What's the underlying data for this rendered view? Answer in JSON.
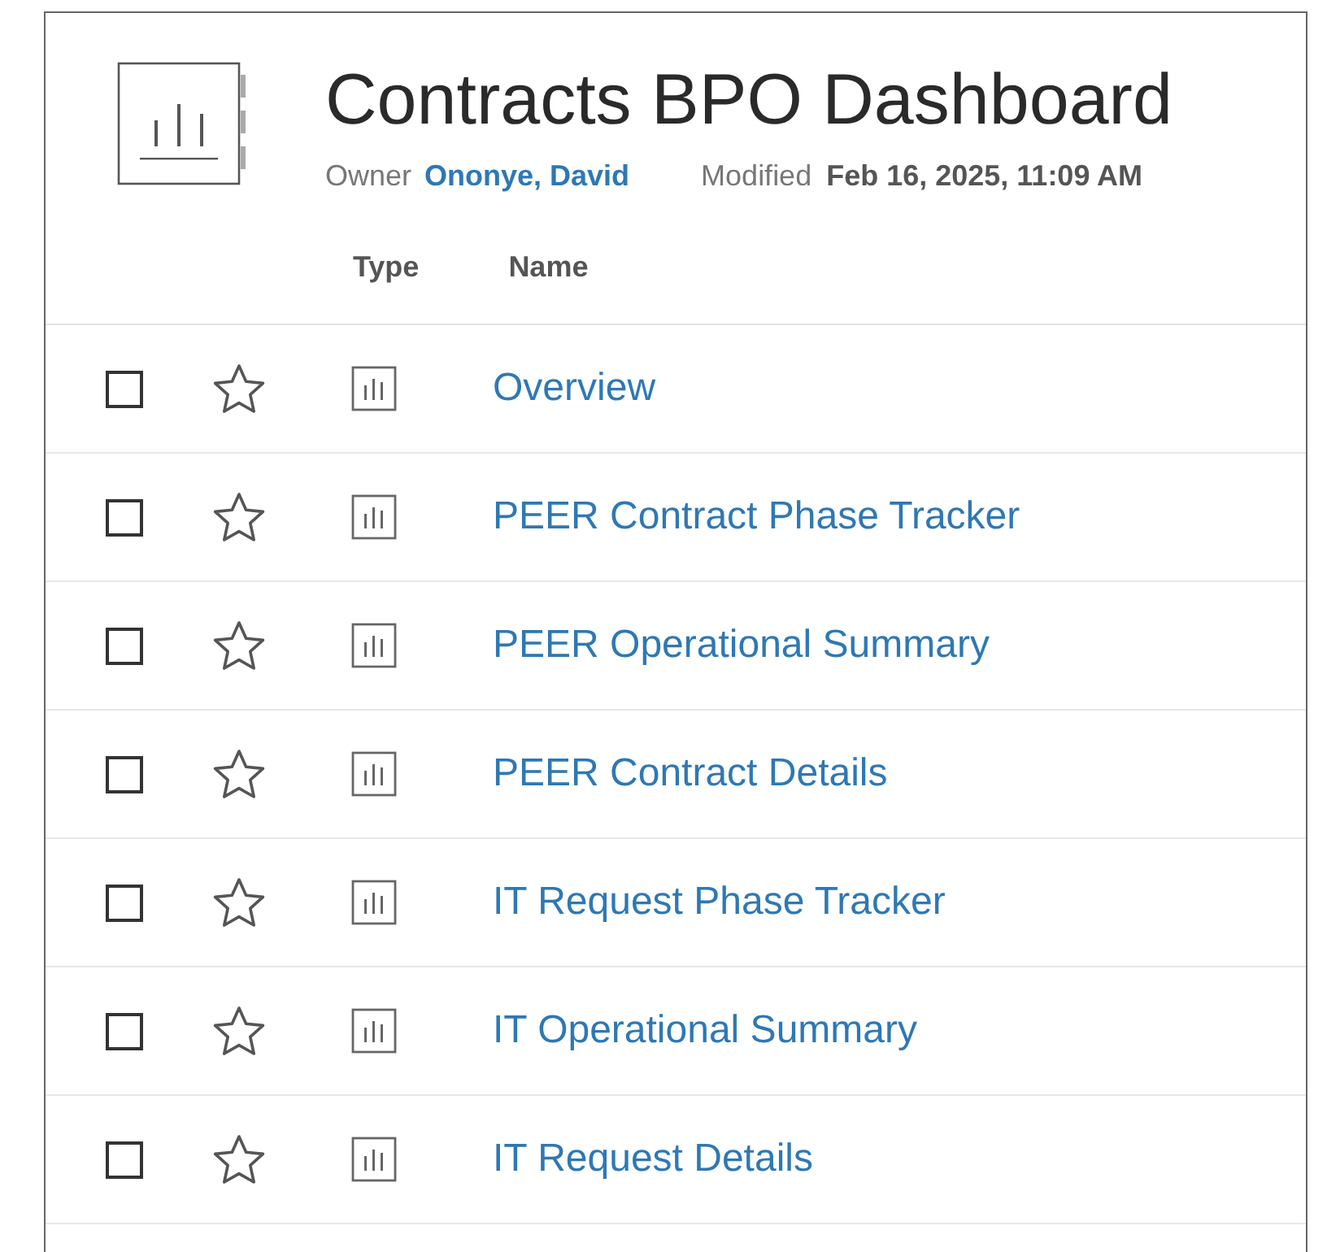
{
  "workbook": {
    "title": "Contracts BPO Dashboard",
    "owner_label": "Owner",
    "owner": "Ononye, David",
    "modified_label": "Modified",
    "modified": "Feb 16, 2025, 11:09 AM"
  },
  "table": {
    "columns": [
      "Type",
      "Name"
    ],
    "rows": [
      {
        "name": "Overview",
        "checked": false,
        "favorite": false
      },
      {
        "name": "PEER Contract Phase Tracker",
        "checked": false,
        "favorite": false
      },
      {
        "name": "PEER Operational Summary",
        "checked": false,
        "favorite": false
      },
      {
        "name": "PEER Contract Details",
        "checked": false,
        "favorite": false
      },
      {
        "name": "IT Request Phase Tracker",
        "checked": false,
        "favorite": false
      },
      {
        "name": "IT Operational Summary",
        "checked": false,
        "favorite": false
      },
      {
        "name": "IT Request Details",
        "checked": false,
        "favorite": false
      }
    ]
  }
}
